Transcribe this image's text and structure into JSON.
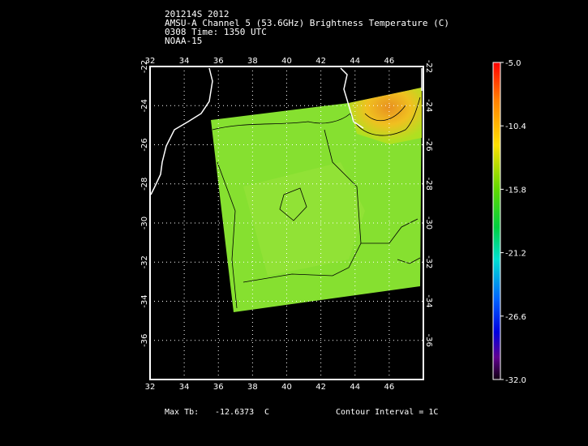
{
  "header": {
    "line1": "201214S 2012",
    "line2": "AMSU-A Channel 5 (53.6GHz) Brightness Temperature (C)",
    "line3": "0308 Time: 1350 UTC",
    "line4": "NOAA-15"
  },
  "footer": {
    "max_label": "Max Tb:",
    "max_value": "-12.6373",
    "max_unit": "C",
    "contour": "Contour Interval = 1C"
  },
  "chart_data": {
    "type": "heatmap",
    "title": "AMSU-A Channel 5 (53.6GHz) Brightness Temperature (C)",
    "x_ticks": [
      "32",
      "34",
      "36",
      "38",
      "40",
      "42",
      "44",
      "46"
    ],
    "y_ticks": [
      "-22",
      "-24",
      "-26",
      "-28",
      "-30",
      "-32",
      "-34",
      "-36"
    ],
    "xlim": [
      32,
      48
    ],
    "ylim": [
      -38,
      -22
    ],
    "colorbar": {
      "ticks": [
        "-5.0",
        "-10.4",
        "-15.8",
        "-21.2",
        "-26.6",
        "-32.0"
      ],
      "range": [
        -32,
        -5
      ],
      "colors": [
        "#ff0000",
        "#ff8000",
        "#ffe000",
        "#80e000",
        "#00d000",
        "#00e0c0",
        "#0080ff",
        "#0000ff",
        "#6000a0",
        "#200020"
      ]
    },
    "max_tb": -12.6373,
    "contour_interval": 1,
    "grid": true,
    "fill_colors": {
      "swath": "#80e030",
      "warm": "#e8a020"
    }
  }
}
